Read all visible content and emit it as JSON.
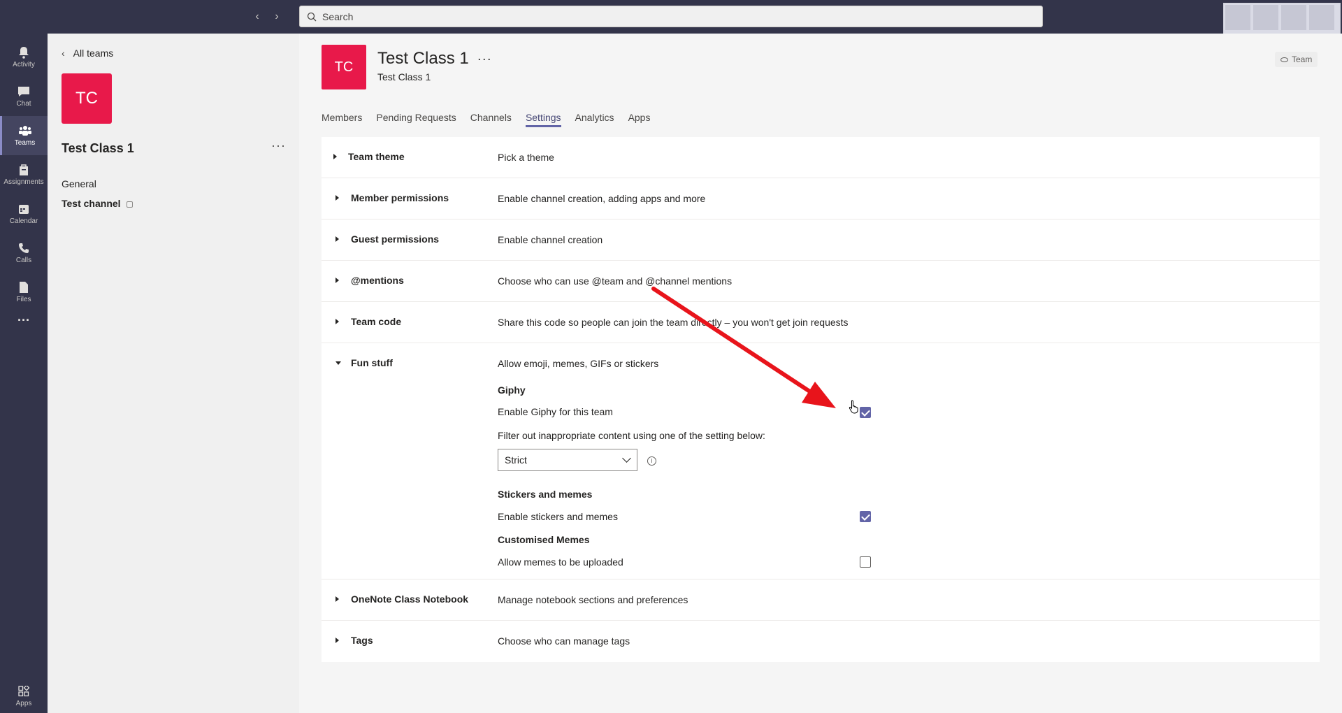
{
  "topbar": {
    "search_placeholder": "Search"
  },
  "rail": {
    "items": [
      {
        "label": "Activity",
        "icon": "bell-icon"
      },
      {
        "label": "Chat",
        "icon": "chat-icon"
      },
      {
        "label": "Teams",
        "icon": "teams-icon"
      },
      {
        "label": "Assignments",
        "icon": "assignments-icon"
      },
      {
        "label": "Calendar",
        "icon": "calendar-icon"
      },
      {
        "label": "Calls",
        "icon": "phone-icon"
      },
      {
        "label": "Files",
        "icon": "file-icon"
      }
    ],
    "more": "···",
    "apps": "Apps"
  },
  "left": {
    "back": "All teams",
    "initials": "TC",
    "team_name": "Test Class 1",
    "more": "···",
    "channels": [
      "General",
      "Test channel"
    ]
  },
  "header": {
    "initials": "TC",
    "title": "Test Class 1",
    "more": "···",
    "subtitle": "Test Class 1",
    "badge": "Team"
  },
  "tabs": [
    "Members",
    "Pending Requests",
    "Channels",
    "Settings",
    "Analytics",
    "Apps"
  ],
  "active_tab": "Settings",
  "sections": [
    {
      "name": "Team theme",
      "desc": "Pick a theme"
    },
    {
      "name": "Member permissions",
      "desc": "Enable channel creation, adding apps and more"
    },
    {
      "name": "Guest permissions",
      "desc": "Enable channel creation"
    },
    {
      "name": "@mentions",
      "desc": "Choose who can use @team and @channel mentions"
    },
    {
      "name": "Team code",
      "desc": "Share this code so people can join the team directly – you won't get join requests"
    },
    {
      "name": "Fun stuff",
      "desc": "Allow emoji, memes, GIFs or stickers"
    },
    {
      "name": "OneNote Class Notebook",
      "desc": "Manage notebook sections and preferences"
    },
    {
      "name": "Tags",
      "desc": "Choose who can manage tags"
    }
  ],
  "fun": {
    "giphy_heading": "Giphy",
    "giphy_enable": "Enable Giphy for this team",
    "giphy_checked": true,
    "filter_label": "Filter out inappropriate content using one of the setting below:",
    "filter_value": "Strict",
    "stickers_heading": "Stickers and memes",
    "stickers_enable": "Enable stickers and memes",
    "stickers_checked": true,
    "custom_heading": "Customised Memes",
    "custom_enable": "Allow memes to be uploaded",
    "custom_checked": false
  },
  "colors": {
    "accent": "#6264a7",
    "team_tile": "#e8194a",
    "rail": "#33344a",
    "annotation_arrow": "#e8141b"
  }
}
